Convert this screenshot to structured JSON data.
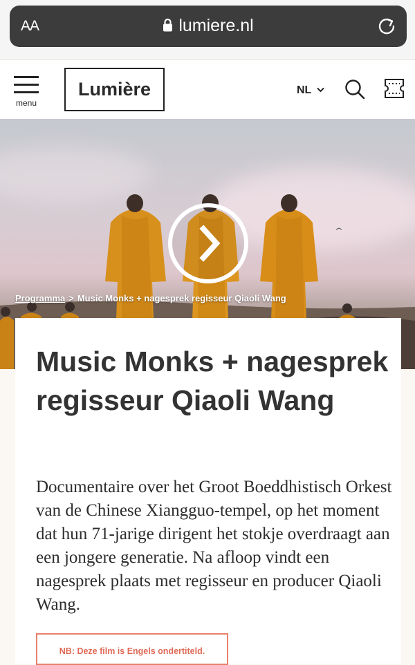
{
  "browser": {
    "text_size_label": "AA",
    "url": "lumiere.nl"
  },
  "header": {
    "menu_label": "menu",
    "logo": "Lumière",
    "language": "NL"
  },
  "breadcrumb": {
    "home": "Programma",
    "separator": ">",
    "current": "Music Monks + nagesprek regisseur Qiaoli Wang"
  },
  "film": {
    "title": "Music Monks + nagesprek regisseur Qiaoli Wang",
    "description": "Documentaire over het Groot Boeddhistisch Orkest van de Chinese Xiangguo-tempel, op het moment dat hun 71-jarige dirigent het stokje overdraagt aan een jongere generatie. Na afloop vindt een nagesprek plaats met regisseur en producer Qiaoli Wang.",
    "note": "NB: Deze film is Engels ondertiteld."
  },
  "icons": {
    "lock": "lock-icon",
    "reload": "reload-icon",
    "menu": "hamburger-icon",
    "chevron": "chevron-down-icon",
    "search": "search-icon",
    "ticket": "ticket-icon",
    "play": "play-icon"
  },
  "colors": {
    "accent": "#e8806a",
    "robe": "#d68a18",
    "text": "#333333"
  }
}
